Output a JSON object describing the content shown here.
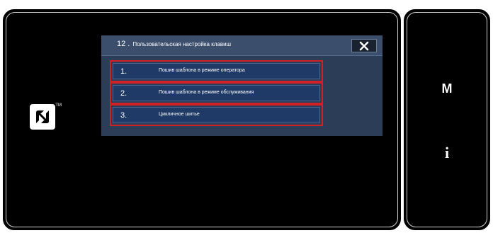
{
  "dialog": {
    "number": "12 .",
    "title": "Пользовательская настройка клавиш",
    "close_label": "✕"
  },
  "options": [
    {
      "number": "1.",
      "label": "Пошив шаблона в режиме оператора"
    },
    {
      "number": "2.",
      "label": "Пошив шаблона в режиме обслуживания"
    },
    {
      "number": "3.",
      "label": "Цикличное шитье"
    }
  ],
  "side_panel": {
    "mode_label": "M",
    "info_label": "i"
  },
  "nfc": {
    "icon": "nfc-icon",
    "trademark": "TM"
  },
  "colors": {
    "highlight": "#d32027",
    "button": "#1f3a66",
    "dialog_bg": "#2c3e57",
    "screen_bg": "#000000"
  }
}
